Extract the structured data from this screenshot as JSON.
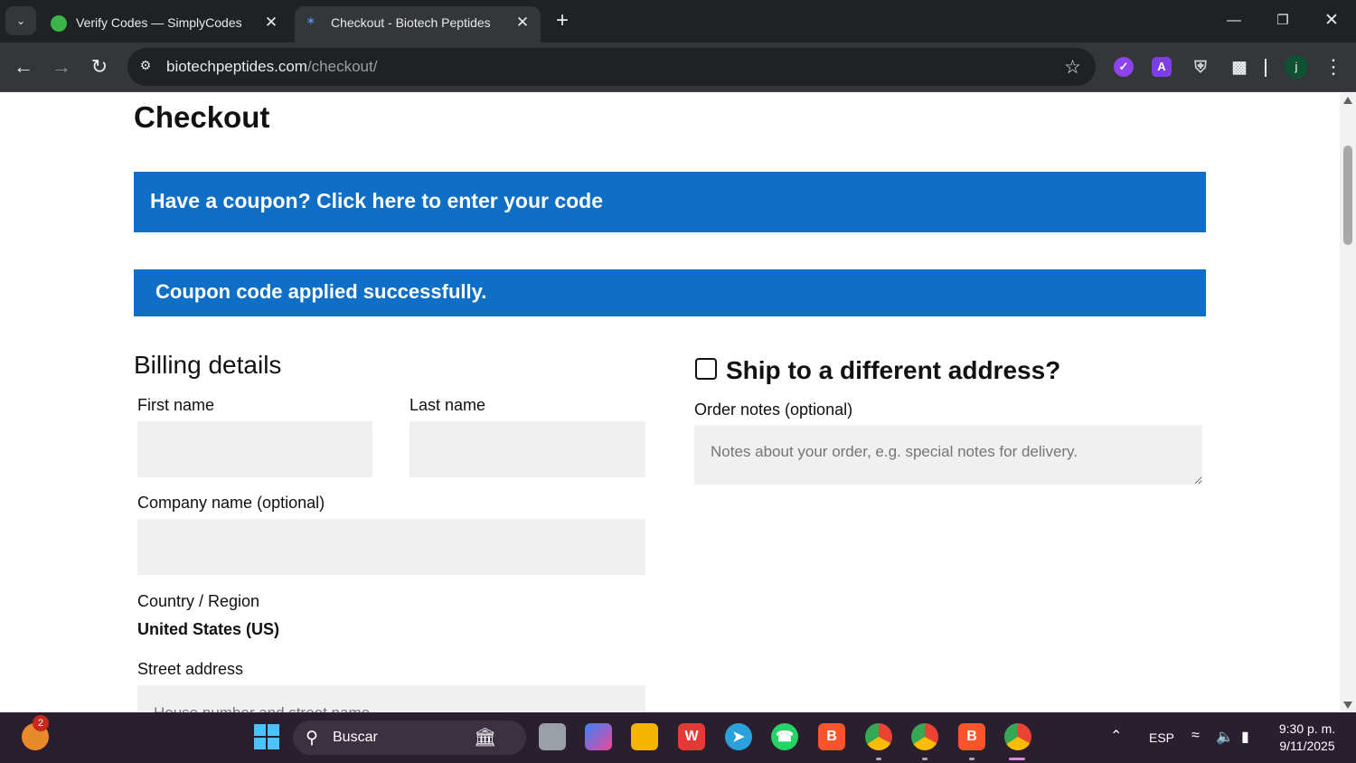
{
  "browser": {
    "tabs": [
      {
        "title": "Verify Codes — SimplyCodes",
        "active": false
      },
      {
        "title": "Checkout - Biotech Peptides",
        "active": true
      }
    ],
    "url_domain": "biotechpeptides.com",
    "url_path": "/checkout/",
    "profile_initial": "j",
    "extensions": [
      "extension-1-icon",
      "extension-a-icon",
      "shield-extension-icon",
      "puzzle-extensions-icon"
    ]
  },
  "page": {
    "title": "Checkout",
    "coupon_notice": "Have a coupon? Click here to enter your code",
    "success_notice": "Coupon code applied successfully.",
    "billing": {
      "heading": "Billing details",
      "first_name_label": "First name",
      "last_name_label": "Last name",
      "company_label": "Company name (optional)",
      "country_label": "Country / Region",
      "country_value": "United States (US)",
      "street_label": "Street address",
      "street_placeholder": "House number and street name"
    },
    "shipping": {
      "ship_label": "Ship to a different address?",
      "notes_label": "Order notes (optional)",
      "notes_placeholder": "Notes about your order, e.g. special notes for delivery."
    }
  },
  "taskbar": {
    "search_placeholder": "Buscar",
    "widget_badge": "2",
    "language": "ESP",
    "time": "9:30 p. m.",
    "date": "9/11/2025"
  },
  "colors": {
    "notice_blue": "#0f6fc6",
    "input_bg": "#f0f0f0",
    "chrome_dark": "#202124",
    "chrome_toolbar": "#35363a"
  }
}
